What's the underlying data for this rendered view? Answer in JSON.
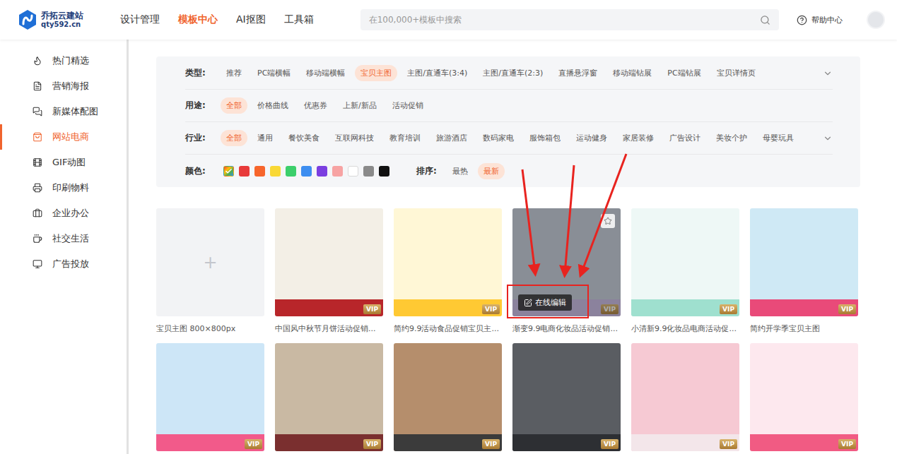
{
  "header": {
    "logo": {
      "name": "乔拓云建站",
      "domain": "qty592.cn"
    },
    "nav": [
      {
        "label": "设计管理",
        "selected": false
      },
      {
        "label": "模板中心",
        "selected": true
      },
      {
        "label": "AI抠图",
        "selected": false
      },
      {
        "label": "工具箱",
        "selected": false
      }
    ],
    "search": {
      "placeholder": "在100,000+模板中搜索"
    },
    "help": "帮助中心"
  },
  "sidebar": {
    "items": [
      {
        "label": "热门精选",
        "selected": false
      },
      {
        "label": "营销海报",
        "selected": false
      },
      {
        "label": "新媒体配图",
        "selected": false
      },
      {
        "label": "网站电商",
        "selected": true
      },
      {
        "label": "GIF动图",
        "selected": false
      },
      {
        "label": "印刷物料",
        "selected": false
      },
      {
        "label": "企业办公",
        "selected": false
      },
      {
        "label": "社交生活",
        "selected": false
      },
      {
        "label": "广告投放",
        "selected": false
      }
    ]
  },
  "filters": {
    "rows": [
      {
        "label": "类型:",
        "expandable": true,
        "options": [
          {
            "label": "推荐",
            "selected": false
          },
          {
            "label": "PC端横幅",
            "selected": false
          },
          {
            "label": "移动端横幅",
            "selected": false
          },
          {
            "label": "宝贝主图",
            "selected": true
          },
          {
            "label": "主图/直通车(3:4)",
            "selected": false
          },
          {
            "label": "主图/直通车(2:3)",
            "selected": false
          },
          {
            "label": "直播悬浮窗",
            "selected": false
          },
          {
            "label": "移动端钻展",
            "selected": false
          },
          {
            "label": "PC端钻展",
            "selected": false
          },
          {
            "label": "宝贝详情页",
            "selected": false
          }
        ]
      },
      {
        "label": "用途:",
        "expandable": false,
        "options": [
          {
            "label": "全部",
            "selected": true
          },
          {
            "label": "价格曲线",
            "selected": false
          },
          {
            "label": "优惠券",
            "selected": false
          },
          {
            "label": "上新/新品",
            "selected": false
          },
          {
            "label": "活动促销",
            "selected": false
          }
        ]
      },
      {
        "label": "行业:",
        "expandable": true,
        "options": [
          {
            "label": "全部",
            "selected": true
          },
          {
            "label": "通用",
            "selected": false
          },
          {
            "label": "餐饮美食",
            "selected": false
          },
          {
            "label": "互联网科技",
            "selected": false
          },
          {
            "label": "教育培训",
            "selected": false
          },
          {
            "label": "旅游酒店",
            "selected": false
          },
          {
            "label": "数码家电",
            "selected": false
          },
          {
            "label": "服饰箱包",
            "selected": false
          },
          {
            "label": "运动健身",
            "selected": false
          },
          {
            "label": "家居装修",
            "selected": false
          },
          {
            "label": "广告设计",
            "selected": false
          },
          {
            "label": "美妆个护",
            "selected": false
          },
          {
            "label": "母婴玩具",
            "selected": false
          }
        ]
      }
    ],
    "colors": {
      "label": "颜色:",
      "swatches": [
        {
          "kind": "all",
          "color": "#3d8ef0",
          "selected": true
        },
        {
          "kind": "solid",
          "color": "#e83a3a",
          "selected": false
        },
        {
          "kind": "solid",
          "color": "#f7652b",
          "selected": false
        },
        {
          "kind": "solid",
          "color": "#f9d835",
          "selected": false
        },
        {
          "kind": "solid",
          "color": "#3ccf6b",
          "selected": false
        },
        {
          "kind": "solid",
          "color": "#3d8ef0",
          "selected": false
        },
        {
          "kind": "solid",
          "color": "#7b3fe0",
          "selected": false
        },
        {
          "kind": "solid",
          "color": "#f7a3a3",
          "selected": false
        },
        {
          "kind": "solid",
          "color": "#ffffff",
          "selected": false
        },
        {
          "kind": "solid",
          "color": "#8a8a8a",
          "selected": false
        },
        {
          "kind": "solid",
          "color": "#111111",
          "selected": false
        }
      ]
    },
    "sort": {
      "label": "排序:",
      "options": [
        {
          "label": "最热",
          "selected": false
        },
        {
          "label": "最新",
          "selected": true
        }
      ]
    }
  },
  "templates": [
    {
      "kind": "blank",
      "symbol": "+",
      "caption": "宝贝主图 800×800px"
    },
    {
      "kind": "template",
      "caption": "中国风中秋节月饼活动促销...",
      "badge": "VIP",
      "vip": true,
      "hovered": false,
      "color": "#f3efe6",
      "accent": "#b8262a"
    },
    {
      "kind": "template",
      "caption": "简约9.9活动食品促销宝贝主...",
      "badge": "VIP",
      "vip": true,
      "hovered": false,
      "color": "#fff7d6",
      "accent": "#ffc933"
    },
    {
      "kind": "template",
      "caption": "渐变9.9电商化妆品活动促销...",
      "badge": "VIP",
      "vip": true,
      "hovered": true,
      "action": "在线编辑",
      "color": "#c5cbd6",
      "accent": "#c9b8e0"
    },
    {
      "kind": "template",
      "caption": "小清新9.9化妆品电商活动促...",
      "badge": "VIP",
      "vip": true,
      "hovered": false,
      "color": "#eef8f6",
      "accent": "#9fe0cf"
    },
    {
      "kind": "template",
      "caption": "简约开学季宝贝主图",
      "badge": "VIP",
      "vip": true,
      "hovered": false,
      "color": "#cfe9f5",
      "accent": "#e94a79"
    },
    {
      "kind": "template",
      "badge": "VIP",
      "vip": true,
      "hovered": false,
      "color": "#cde6f7",
      "accent": "#f25a8a"
    },
    {
      "kind": "template",
      "badge": "VIP",
      "vip": true,
      "hovered": false,
      "color": "#c9b9a3",
      "accent": "#7a2f2f"
    },
    {
      "kind": "template",
      "badge": "VIP",
      "vip": true,
      "hovered": false,
      "color": "#b58e6c",
      "accent": "#3b3b3b"
    },
    {
      "kind": "template",
      "badge": "VIP",
      "vip": true,
      "hovered": false,
      "color": "#5a5d62",
      "accent": "#2d2f33"
    },
    {
      "kind": "template",
      "badge": "VIP",
      "vip": true,
      "hovered": false,
      "color": "#f6c9d3",
      "accent": "#f3e6ea"
    },
    {
      "kind": "template",
      "badge": "VIP",
      "vip": true,
      "hovered": false,
      "color": "#fde8ee",
      "accent": "#f15b83"
    }
  ]
}
